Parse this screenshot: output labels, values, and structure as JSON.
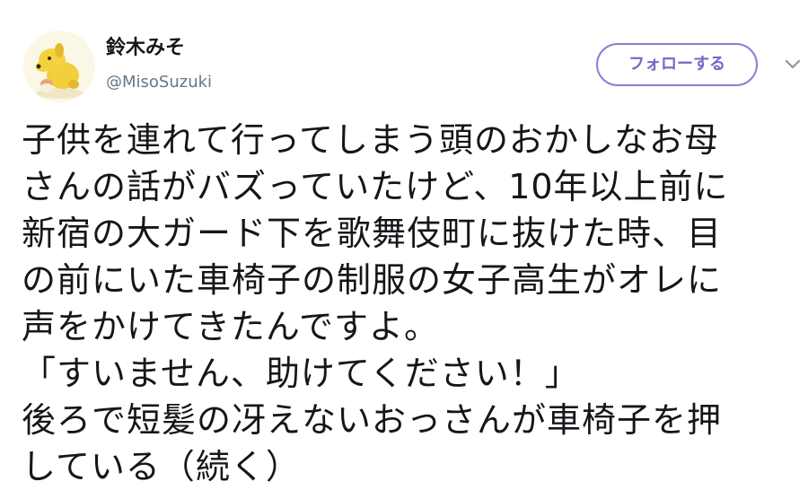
{
  "user": {
    "display_name": "鈴木みそ",
    "screen_name": "@MisoSuzuki",
    "avatar_icon": "dog-avatar-icon"
  },
  "actions": {
    "follow_label": "フォローする",
    "more_icon": "chevron-down-icon"
  },
  "colors": {
    "follow_accent": "#7b65c6",
    "handle_gray": "#657786",
    "text": "#14171a"
  },
  "tweet": {
    "lines": [
      "子供を連れて行ってしまう頭のおかしなお母",
      "さんの話がバズっていたけど、10年以上前に",
      "新宿の大ガード下を歌舞伎町に抜けた時、目",
      "の前にいた車椅子の制服の女子高生がオレに",
      "声をかけてきたんですよ。",
      "「すいません、助けてください！」",
      "後ろで短髪の冴えないおっさんが車椅子を押",
      "している（続く）"
    ]
  }
}
